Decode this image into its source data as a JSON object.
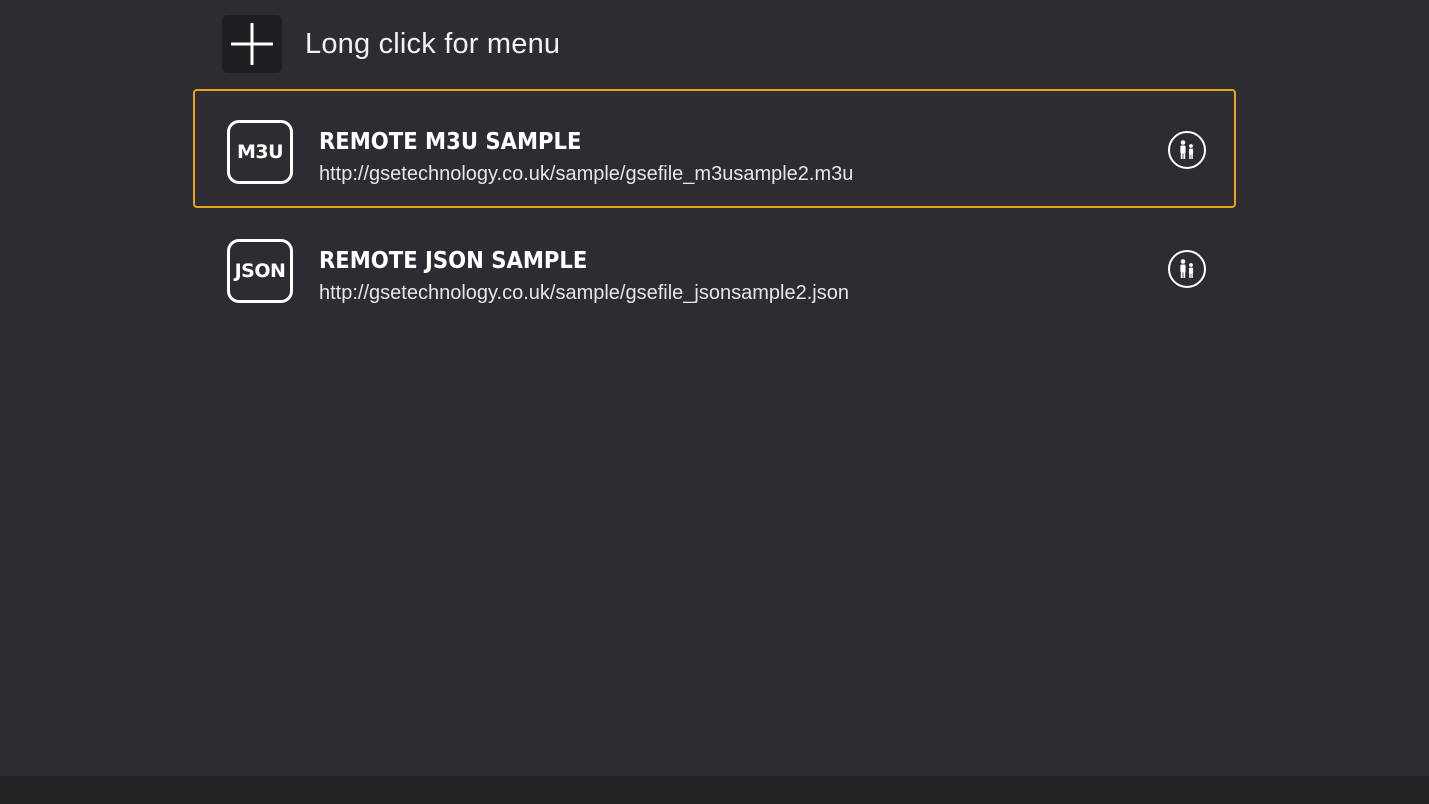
{
  "header": {
    "add_label": "Long click for menu",
    "add_icon": "plus-icon"
  },
  "playlists": [
    {
      "badge": "M3U",
      "title": "REMOTE M3U SAMPLE",
      "url": "http://gsetechnology.co.uk/sample/gsefile_m3usample2.m3u",
      "icon": "family-icon",
      "focused": true
    },
    {
      "badge": "JSON",
      "title": "REMOTE JSON SAMPLE",
      "url": "http://gsetechnology.co.uk/sample/gsefile_jsonsample2.json",
      "icon": "family-icon",
      "focused": false
    }
  ],
  "colors": {
    "background": "#2c2c32",
    "focus_border": "#e8a317",
    "add_button_bg": "#1f1f23",
    "bottom_bar": "#232326"
  }
}
